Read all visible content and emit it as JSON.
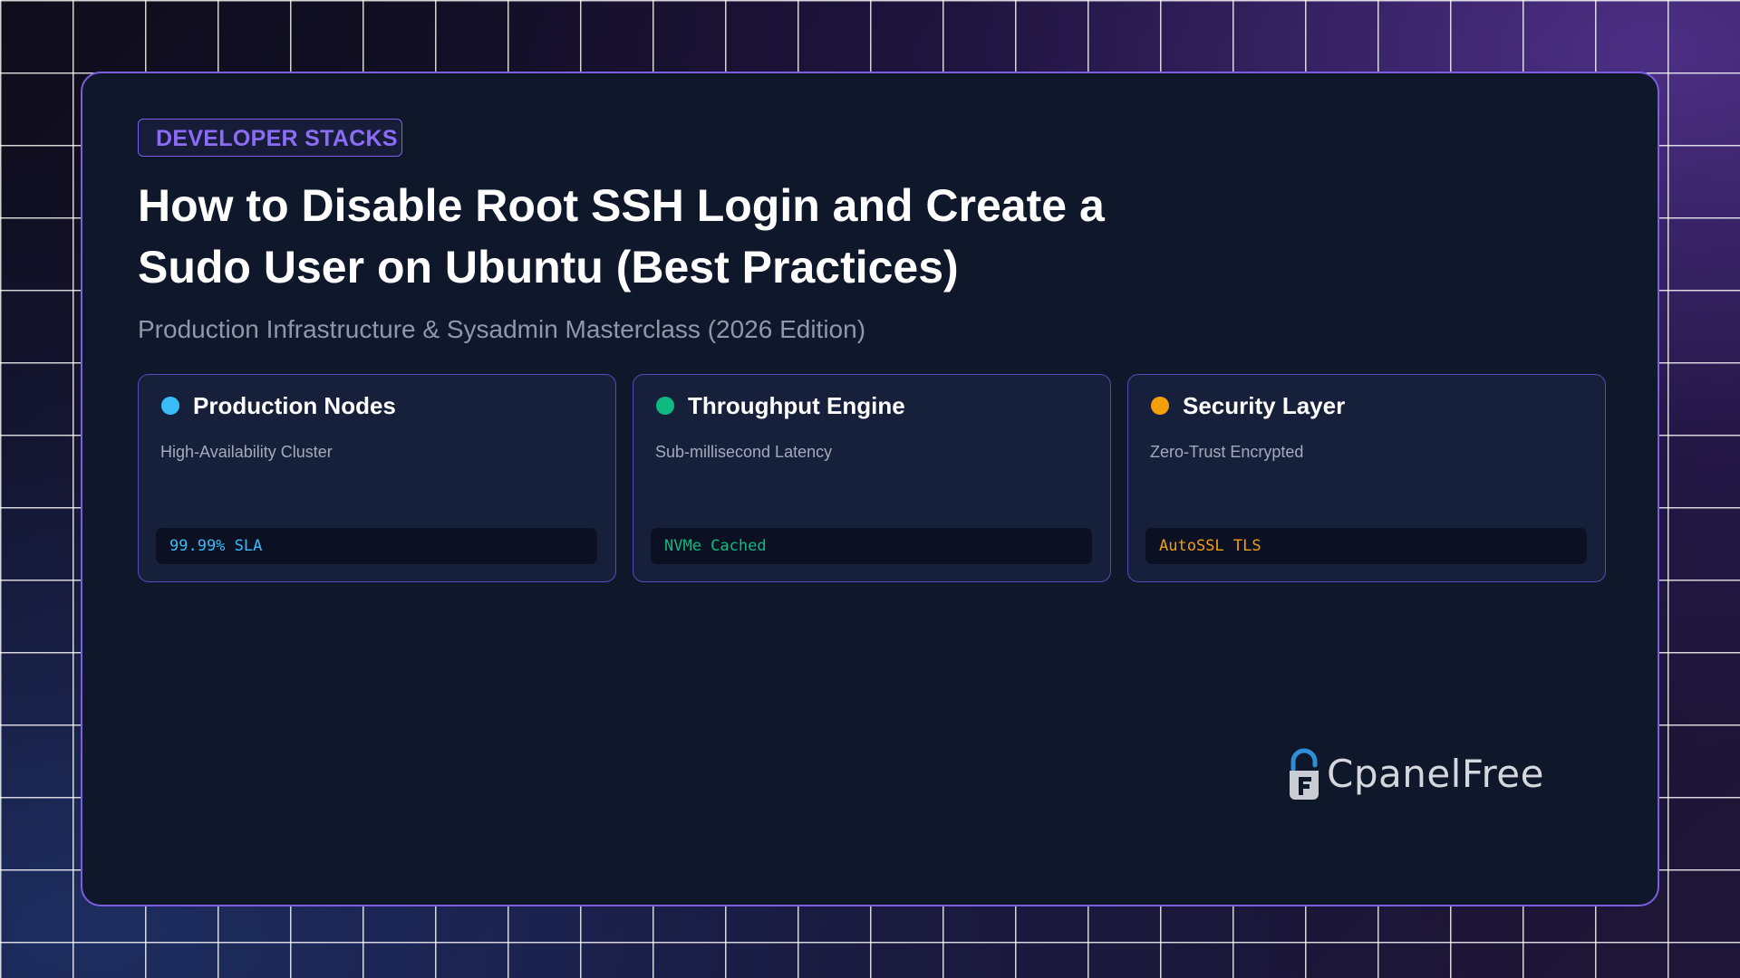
{
  "badge": "DEVELOPER STACKS",
  "title": "How to Disable Root SSH Login and Create a Sudo User on Ubuntu (Best Practices)",
  "subtitle": "Production Infrastructure & Sysadmin Masterclass (2026 Edition)",
  "cards": [
    {
      "title": "Production Nodes",
      "description": "High-Availability Cluster",
      "code": "99.99% SLA",
      "accent": "#38bdf8"
    },
    {
      "title": "Throughput Engine",
      "description": "Sub-millisecond Latency",
      "code": "NVMe Cached",
      "accent": "#10b981"
    },
    {
      "title": "Security Layer",
      "description": "Zero-Trust Encrypted",
      "code": "AutoSSL TLS",
      "accent": "#f59e0b"
    }
  ],
  "logo": {
    "text": "CpanelFree",
    "icon": "padlock-f-icon"
  },
  "colors": {
    "panel_border": "#7a5ee0",
    "badge": "#8b6cf7",
    "panel_background": "#0f172a"
  }
}
